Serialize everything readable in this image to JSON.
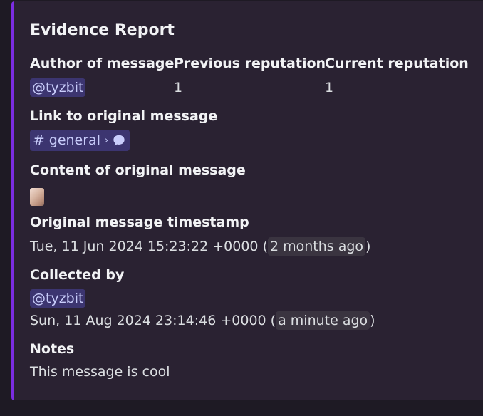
{
  "embed": {
    "title": "Evidence Report",
    "fields": {
      "author": {
        "name": "Author of message",
        "value": "@tyzbit"
      },
      "previous_reputation": {
        "name": "Previous reputation",
        "value": "1"
      },
      "current_reputation": {
        "name": "Current reputation",
        "value": "1"
      },
      "link": {
        "name": "Link to original message",
        "channel_hash": "#",
        "channel": "general",
        "separator": "›",
        "icon": "speech-bubble-icon"
      },
      "content": {
        "name": "Content of original message",
        "attachment_icon": "image-thumbnail"
      },
      "timestamp": {
        "name": "Original message timestamp",
        "absolute": "Tue, 11 Jun 2024 15:23:22 +0000",
        "open_paren": "(",
        "relative": "2 months ago",
        "close_paren": ")"
      },
      "collected_by": {
        "name": "Collected by",
        "user": "@tyzbit",
        "absolute": "Sun, 11 Aug 2024 23:14:46 +0000",
        "open_paren": "(",
        "relative": "a minute ago",
        "close_paren": ")"
      },
      "notes": {
        "name": "Notes",
        "value": "This message is cool"
      }
    }
  },
  "colors": {
    "accent_bar": "#7b2de0",
    "embed_background": "#2a2232",
    "page_background": "#1e1a24",
    "mention_background": "#3c3570",
    "mention_text": "#c9cdfb"
  }
}
